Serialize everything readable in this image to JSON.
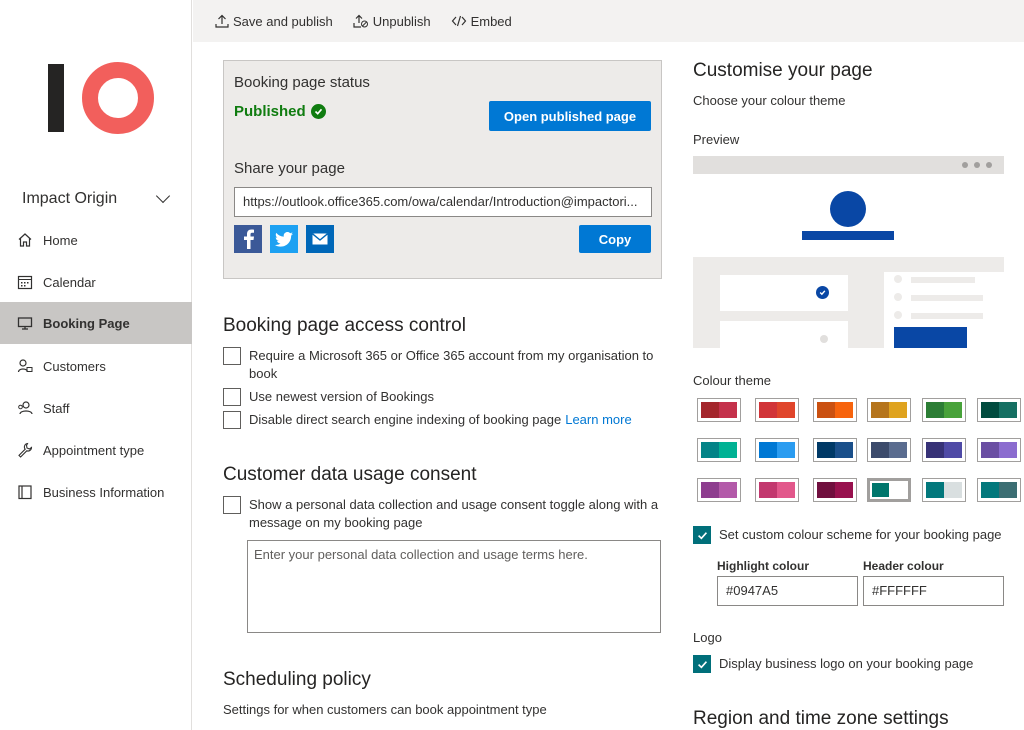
{
  "sidebar": {
    "business_name": "Impact Origin",
    "items": [
      {
        "label": "Home",
        "icon": "home-icon"
      },
      {
        "label": "Calendar",
        "icon": "calendar-icon"
      },
      {
        "label": "Booking Page",
        "icon": "monitor-icon",
        "active": true
      },
      {
        "label": "Customers",
        "icon": "customers-icon"
      },
      {
        "label": "Staff",
        "icon": "staff-icon"
      },
      {
        "label": "Appointment type",
        "icon": "wrench-icon"
      },
      {
        "label": "Business Information",
        "icon": "book-icon"
      }
    ]
  },
  "toolbar": {
    "save_publish": "Save and publish",
    "unpublish": "Unpublish",
    "embed": "Embed"
  },
  "status": {
    "title": "Booking page status",
    "state": "Published",
    "open_button": "Open published page",
    "share_title": "Share your page",
    "url": "https://outlook.office365.com/owa/calendar/Introduction@impactori...",
    "copy_button": "Copy"
  },
  "access": {
    "title": "Booking page access control",
    "require_account": "Require a Microsoft 365 or Office 365 account from my organisation to book",
    "newest_version": "Use newest version of Bookings",
    "disable_indexing": "Disable direct search engine indexing of booking page",
    "learn_more": "Learn more"
  },
  "consent": {
    "title": "Customer data usage consent",
    "toggle_label": "Show a personal data collection and usage consent toggle along with a message on my booking page",
    "placeholder": "Enter your personal data collection and usage terms here."
  },
  "scheduling": {
    "title": "Scheduling policy",
    "subtitle": "Settings for when customers can book appointment type"
  },
  "customise": {
    "title": "Customise your page",
    "subtitle": "Choose your colour theme",
    "preview_label": "Preview",
    "theme_label": "Colour theme",
    "custom_scheme": "Set custom colour scheme for your booking page",
    "highlight_label": "Highlight colour",
    "highlight_value": "#0947A5",
    "header_label": "Header colour",
    "header_value": "#FFFFFF",
    "logo_label": "Logo",
    "display_logo": "Display business logo on your booking page",
    "region_title": "Region and time zone settings"
  },
  "colors": {
    "accent": "#0078d4",
    "published": "#107c10",
    "highlight": "#0947A5",
    "checkbox": "#006f7a",
    "logo_bar": "#252423",
    "logo_ring": "#f25f5c"
  },
  "themes": [
    [
      "#a4262c",
      "#c4314b"
    ],
    [
      "#d13438",
      "#e0452b"
    ],
    [
      "#ca5010",
      "#f7630c"
    ],
    [
      "#b5741b",
      "#dfa31f"
    ],
    [
      "#2c7d35",
      "#48a23a"
    ],
    [
      "#004b3e",
      "#156f62"
    ],
    [
      "#038387",
      "#00b294"
    ],
    [
      "#0078d4",
      "#2b9cf0"
    ],
    [
      "#003966",
      "#1a4f8a"
    ],
    [
      "#3b4a6b",
      "#5a6c8f"
    ],
    [
      "#373277",
      "#4f4aa6"
    ],
    [
      "#6a4ea3",
      "#8b6ccf"
    ],
    [
      "#8e3d8f",
      "#b35aa9"
    ],
    [
      "#c2386e",
      "#e2588b"
    ],
    [
      "#700f3e",
      "#98114e"
    ],
    [
      "#00766c",
      "#ffffff"
    ],
    [
      "#03787c",
      "#d9dfe0"
    ],
    [
      "#03787c",
      "#3c6e73"
    ]
  ]
}
